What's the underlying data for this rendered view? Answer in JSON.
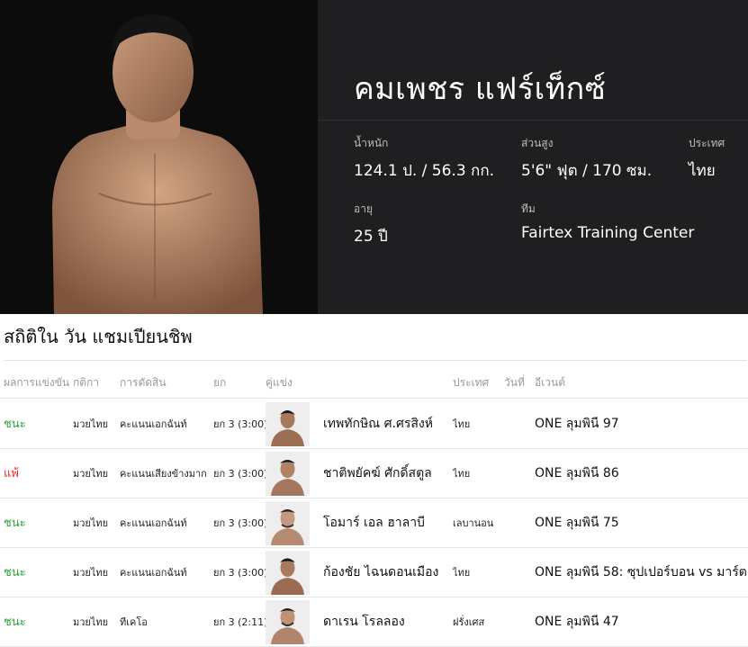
{
  "profile": {
    "name": "คมเพชร แฟร์เท็กซ์",
    "weight_label": "น้ำหนัก",
    "weight_value": "124.1 ป. / 56.3 กก.",
    "height_label": "ส่วนสูง",
    "height_value": "5'6\" ฟุต / 170 ซม.",
    "country_label": "ประเทศ",
    "country_value": "ไทย",
    "age_label": "อายุ",
    "age_value": "25 ปี",
    "team_label": "ทีม",
    "team_value": "Fairtex Training Center"
  },
  "stats": {
    "title": "สถิติใน วัน แชมเปียนชิพ",
    "columns": {
      "result": "ผลการแข่งขัน",
      "rule": "กติกา",
      "method": "การตัดสิน",
      "round": "ยก",
      "opponent": "คู่แข่ง",
      "country": "ประเทศ",
      "date": "วันที่",
      "event": "อีเวนต์"
    },
    "rows": [
      {
        "result": "ชนะ",
        "result_type": "win",
        "rule": "มวยไทย",
        "method": "คะแนนเอกฉันท์",
        "round": "ยก 3 (3:00)",
        "opponent": "เทพทักษิณ ศ.ศรสิงห์",
        "country": "ไทย",
        "event": "ONE ลุมพินี 97"
      },
      {
        "result": "แพ้",
        "result_type": "loss",
        "rule": "มวยไทย",
        "method": "คะแนนเสียงข้างมาก",
        "round": "ยก 3 (3:00)",
        "opponent": "ชาติพยัคฆ์ ศักดิ์สตูล",
        "country": "ไทย",
        "event": "ONE ลุมพินี 86"
      },
      {
        "result": "ชนะ",
        "result_type": "win",
        "rule": "มวยไทย",
        "method": "คะแนนเอกฉันท์",
        "round": "ยก 3 (3:00)",
        "opponent": "โอมาร์ เอล ฮาลาบี",
        "country": "เลบานอน",
        "event": "ONE ลุมพินี 75"
      },
      {
        "result": "ชนะ",
        "result_type": "win",
        "rule": "มวยไทย",
        "method": "คะแนนเอกฉันท์",
        "round": "ยก 3 (3:00)",
        "opponent": "ก้องชัย ไฉนดอนเมือง",
        "country": "ไทย",
        "event": "ONE ลุมพินี 58: ซุปเปอร์บอน vs มาร์ต"
      },
      {
        "result": "ชนะ",
        "result_type": "win",
        "rule": "มวยไทย",
        "method": "ทีเคโอ",
        "round": "ยก 3 (2:11)",
        "opponent": "ดาเรน โรลลอง",
        "country": "ฝรั่งเศส",
        "event": "ONE ลุมพินี 47"
      }
    ]
  },
  "colors": {
    "win": "#2f9e3f",
    "loss": "#e0302a",
    "hero_bg": "#1f1f21"
  }
}
